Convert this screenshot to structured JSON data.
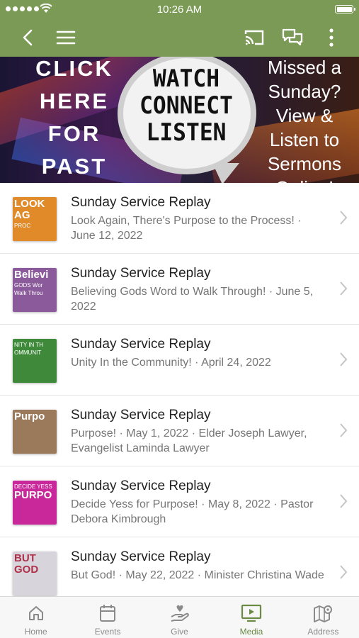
{
  "status": {
    "time": "10:26 AM"
  },
  "toolbar": {
    "back_icon": "chevron-left-icon",
    "menu_icon": "hamburger-icon",
    "cast_icon": "cast-icon",
    "chat_icon": "chat-icon",
    "more_icon": "more-vertical-icon"
  },
  "banner": {
    "left_lines": [
      "CLICK",
      "HERE",
      "FOR",
      "PAST"
    ],
    "bubble_lines": [
      "WATCH",
      "CONNECT",
      "LISTEN"
    ],
    "right_lines": [
      "Missed a",
      "Sunday?",
      "View &",
      "Listen to",
      "Sermons",
      "Online!"
    ]
  },
  "items": [
    {
      "title": "Sunday Service Replay",
      "subtitle": "Look Again, There's Purpose to the Process! · June 12, 2022",
      "thumb_lines": [
        "LOOK AG",
        "PROC"
      ],
      "thumb_color": "#e08a2a"
    },
    {
      "title": "Sunday Service Replay",
      "subtitle": "Believing Gods Word to Walk Through! · June 5, 2022",
      "thumb_lines": [
        "Believi",
        "GODS Wor",
        "Walk Throu"
      ],
      "thumb_color": "#8a5a9a"
    },
    {
      "title": "Sunday Service Replay",
      "subtitle": "Unity In the Community! · April 24, 2022",
      "thumb_lines": [
        "NITY IN TH",
        "OMMUNIT"
      ],
      "thumb_color": "#3e8a3a"
    },
    {
      "title": "Sunday Service Replay",
      "subtitle": "Purpose! · May 1, 2022 · Elder Joseph Lawyer, Evangelist Laminda Lawyer",
      "thumb_lines": [
        "Purpo"
      ],
      "thumb_color": "#9a7a5a"
    },
    {
      "title": "Sunday Service Replay",
      "subtitle": "Decide Yess for Purpose! · May 8, 2022 · Pastor Debora Kimbrough",
      "thumb_lines": [
        "DECIDE YESS",
        "PURPO"
      ],
      "thumb_color": "#c8289a"
    },
    {
      "title": "Sunday Service Replay",
      "subtitle": "But God! · May 22, 2022 · Minister Christina Wade",
      "thumb_lines": [
        "BUT",
        "GOD"
      ],
      "thumb_color": "#d8d4dc"
    }
  ],
  "tabs": [
    {
      "label": "Home",
      "icon": "home-icon",
      "active": false
    },
    {
      "label": "Events",
      "icon": "calendar-icon",
      "active": false
    },
    {
      "label": "Give",
      "icon": "give-hand-icon",
      "active": false
    },
    {
      "label": "Media",
      "icon": "tv-play-icon",
      "active": true
    },
    {
      "label": "Address",
      "icon": "map-pin-icon",
      "active": false
    }
  ],
  "colors": {
    "brand_green": "#7a9a55",
    "active_tab": "#6b8a46"
  }
}
